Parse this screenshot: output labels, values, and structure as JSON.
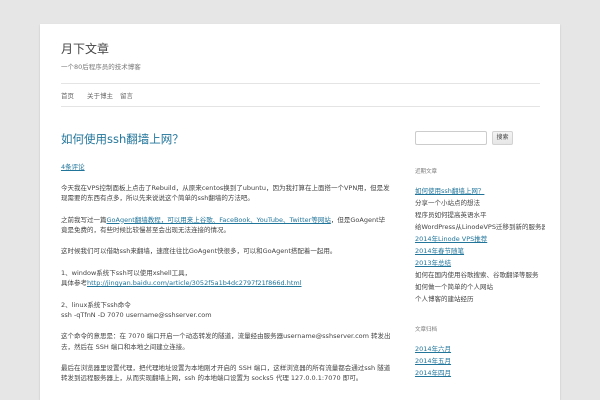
{
  "site": {
    "title": "月下文章",
    "description": "一个80后程序员的技术博客"
  },
  "nav": {
    "items": [
      {
        "label": "首页"
      },
      {
        "label": "关于博主"
      },
      {
        "label": "留言"
      }
    ]
  },
  "post": {
    "title": "如何使用ssh翻墙上网？",
    "comments_link": "4条评论",
    "paragraphs": [
      {
        "text": "今天我在VPS控制面板上点击了Rebuild，从原来centos换到了ubuntu，因为我打算在上面搭一个VPN用，但是发现需要的东西有点多，所以先来说说这个简单的ssh翻墙的方法吧。"
      },
      {
        "pre": "之前我写过一篇",
        "link": "GoAgent翻墙教程，可以用来上谷歌、FaceBook、YouTube、Twitter等网站",
        "post": "，但是GoAgent毕竟是免费的，有些时候比较慢甚至会出现无法连接的情况。"
      },
      {
        "text": "这时候我们可以借助ssh来翻墙，速度往往比GoAgent快很多，可以和GoAgent搭配着一起用。"
      },
      {
        "line1": "1、window系统下ssh可以使用xshell工具，",
        "line2_pre": "具体参考",
        "line2_link": "http://jingyan.baidu.com/article/3052f5a1b4dc2797f21f866d.html"
      },
      {
        "line1": "2、linux系统下ssh命令",
        "line2": "ssh -qTfnN -D 7070 username@sshserver.com"
      },
      {
        "text": "这个命令的意思是：在 7070 端口开启一个动态转发的隧道，流量经由服务器username@sshserver.com 转发出去，然后在 SSH 端口和本地之间建立连接。"
      },
      {
        "text": "最后在浏览器里设置代理，把代理地址设置为本地刚才开启的 SSH 端口，这样浏览器的所有流量都会通过ssh 隧道转发到远程服务器上，从而实现翻墙上网，ssh 的本地端口设置为 socks5 代理 127.0.0.1:7070 即可。"
      }
    ]
  },
  "sidebar": {
    "search_button": "搜索",
    "recent_title": "近期文章",
    "recent_posts": [
      {
        "label": "如何使用ssh翻墙上网？",
        "link": true
      },
      {
        "label": "分享一个小站点的想法",
        "link": false
      },
      {
        "label": "程序员如何提高英语水平",
        "link": false
      },
      {
        "label": "给WordPress从LinodeVPS迁移到新的服务器",
        "link": false
      },
      {
        "label": "2014年Linode VPS推荐",
        "link": true
      },
      {
        "label": "2014年春节随笔",
        "link": true
      },
      {
        "label": "2013年总结",
        "link": true
      },
      {
        "label": "如何在国内使用谷歌搜索、谷歌翻译等服务",
        "link": false
      },
      {
        "label": "如何做一个简单的个人网站",
        "link": false
      },
      {
        "label": "个人博客的建站经历",
        "link": false
      }
    ],
    "archives_title": "文章归档",
    "archives": [
      {
        "label": "2014年六月"
      },
      {
        "label": "2014年五月"
      },
      {
        "label": "2014年四月"
      }
    ]
  },
  "colors": {
    "link": "#21759b",
    "background": "#e6e6e6",
    "page": "#ffffff"
  }
}
